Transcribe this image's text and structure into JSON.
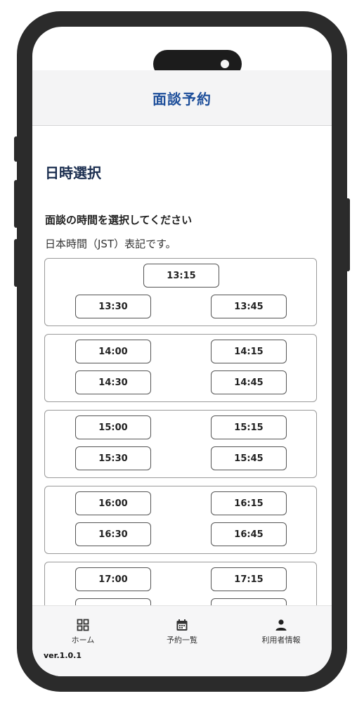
{
  "header": {
    "title": "面談予約"
  },
  "section": {
    "title": "日時選択",
    "instruction": "面談の時間を選択してください",
    "timezone_note": "日本時間（JST）表記です。"
  },
  "slot_groups": [
    {
      "slots": [
        "13:15",
        "13:30",
        "13:45"
      ]
    },
    {
      "slots": [
        "14:00",
        "14:15",
        "14:30",
        "14:45"
      ]
    },
    {
      "slots": [
        "15:00",
        "15:15",
        "15:30",
        "15:45"
      ]
    },
    {
      "slots": [
        "16:00",
        "16:15",
        "16:30",
        "16:45"
      ]
    },
    {
      "slots": [
        "17:00",
        "17:15",
        "",
        ""
      ]
    }
  ],
  "tabbar": {
    "tabs": [
      {
        "label": "ホーム",
        "icon": "grid-icon"
      },
      {
        "label": "予約一覧",
        "icon": "calendar-icon"
      },
      {
        "label": "利用者情報",
        "icon": "person-icon"
      }
    ],
    "version": "ver.1.0.1"
  },
  "colors": {
    "accent": "#1d4e9a",
    "frame": "#2b2b2b"
  }
}
